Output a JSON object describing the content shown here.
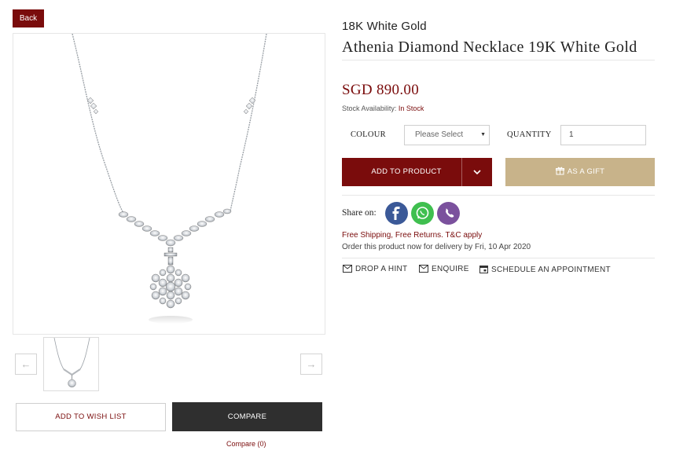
{
  "nav": {
    "back_label": "Back"
  },
  "gallery": {
    "main_image": "necklace-snowflake-pendant",
    "prev_icon": "←",
    "next_icon": "→",
    "thumbnails": [
      "necklace-thumbnail"
    ]
  },
  "actions_left": {
    "wish_list_label": "ADD TO WISH LIST",
    "compare_label": "COMPARE",
    "compare_link": "Compare (0)"
  },
  "product": {
    "category": "18K White Gold",
    "title": "Athenia Diamond Necklace 19K White Gold",
    "price": "SGD 890.00",
    "stock_label": "Stock Availability:",
    "stock_value": "In Stock"
  },
  "options": {
    "colour_label": "COLOUR",
    "colour_value": "Please Select",
    "quantity_label": "QUANTITY",
    "quantity_value": "1"
  },
  "buttons": {
    "add_label": "ADD TO PRODUCT",
    "gift_label": "AS A GIFT"
  },
  "share": {
    "label": "Share on:",
    "icons": [
      "facebook-icon",
      "whatsapp-icon",
      "viber-icon"
    ]
  },
  "shipping": {
    "free_text": "Free Shipping, Free Returns. T&C apply",
    "delivery_text": "Order this product now for delivery by Fri, 10 Apr 2020"
  },
  "links": {
    "hint": "DROP A HINT",
    "enquire": "ENQUIRE",
    "appointment": "SCHEDULE AN APPOINTMENT"
  },
  "colors": {
    "brand": "#7a0c0c",
    "gift": "#c8b38a",
    "dark": "#2f2f2f",
    "facebook": "#3b5998",
    "whatsapp": "#3fbf4f",
    "viber": "#7b519d"
  }
}
